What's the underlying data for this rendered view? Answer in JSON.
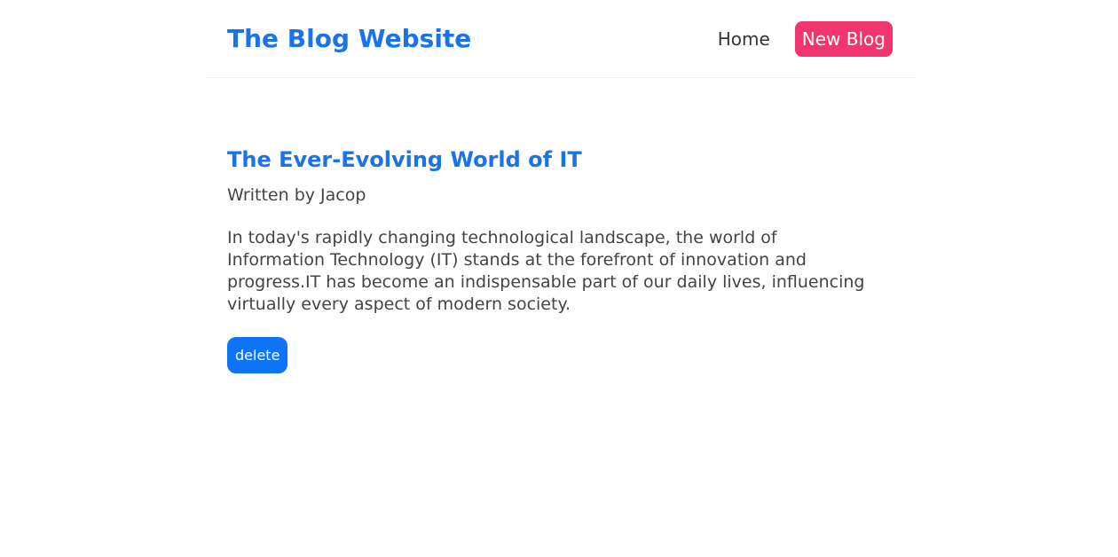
{
  "navbar": {
    "brand": "The Blog Website",
    "links": {
      "home": "Home",
      "new_blog": "New Blog"
    }
  },
  "blog": {
    "title": "The Ever-Evolving World of IT",
    "author_line": "Written by Jacop",
    "body": "In today's rapidly changing technological landscape, the world of Information Technology (IT) stands at the forefront of innovation and progress.IT has become an indispensable part of our daily lives, influencing virtually every aspect of modern society.",
    "delete_label": "delete"
  },
  "colors": {
    "brand": "#1a73e8",
    "new_blog_button": "#f1356d",
    "delete_button": "#0d75f5",
    "text": "#444444"
  }
}
